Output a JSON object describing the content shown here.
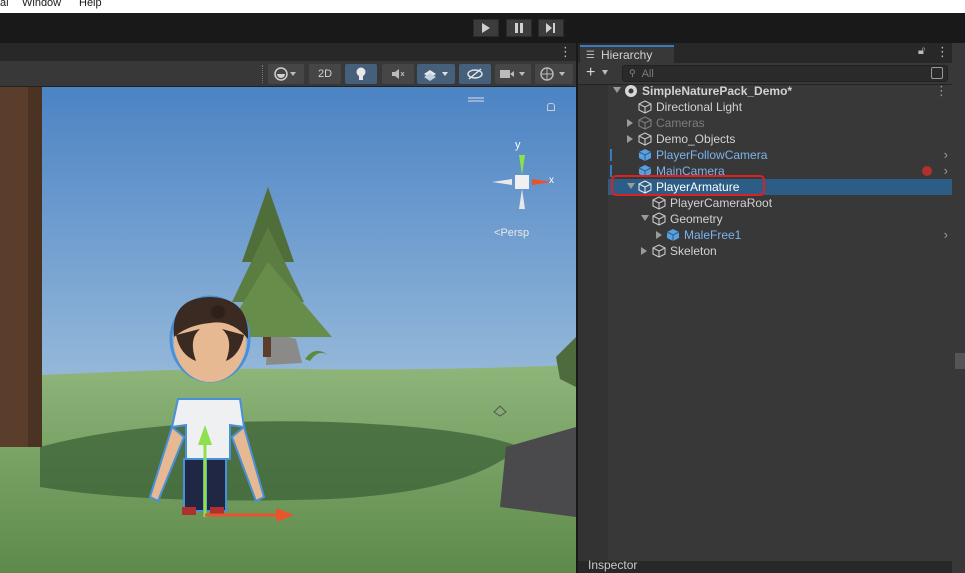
{
  "menu": {
    "items": [
      "al",
      "Window",
      "Help"
    ]
  },
  "playbar": {
    "play": "play",
    "pause": "pause",
    "step": "step"
  },
  "scene": {
    "toolbar": {
      "mode_2d": "2D"
    },
    "gizmo": {
      "y_label": "y",
      "x_label": "x",
      "projection": "Persp"
    }
  },
  "hierarchy": {
    "tab_label": "Hierarchy",
    "search_placeholder": "All",
    "add_label": "+",
    "items": [
      {
        "label": "SimpleNaturePack_Demo*"
      },
      {
        "label": "Directional Light"
      },
      {
        "label": "Cameras"
      },
      {
        "label": "Demo_Objects"
      },
      {
        "label": "PlayerFollowCamera"
      },
      {
        "label": "MainCamera"
      },
      {
        "label": "PlayerArmature"
      },
      {
        "label": "PlayerCameraRoot"
      },
      {
        "label": "Geometry"
      },
      {
        "label": "MaleFree1"
      },
      {
        "label": "Skeleton"
      }
    ],
    "selected": "PlayerArmature"
  },
  "inspector": {
    "tab_label": "Inspector"
  },
  "colors": {
    "selection": "#2c5d87",
    "prefab_text": "#7cb3ec",
    "highlight_outline": "#e02020",
    "tab_accent": "#3a79bb"
  }
}
